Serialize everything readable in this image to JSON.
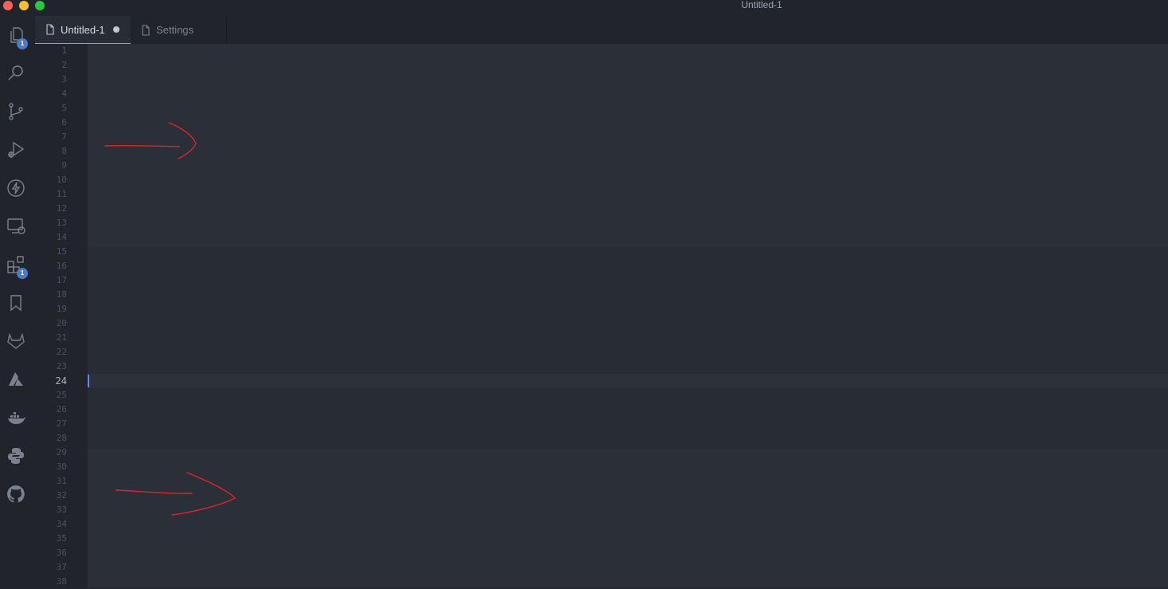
{
  "window": {
    "title": "Untitled-1"
  },
  "activity_bar": {
    "items": [
      {
        "icon": "files-icon",
        "badge": "1"
      },
      {
        "icon": "search-icon"
      },
      {
        "icon": "source-control-icon"
      },
      {
        "icon": "run-debug-icon"
      },
      {
        "icon": "lightning-icon"
      },
      {
        "icon": "remote-explorer-icon"
      },
      {
        "icon": "extensions-icon",
        "badge": "1"
      },
      {
        "icon": "bookmark-icon"
      },
      {
        "icon": "gitlab-icon"
      },
      {
        "icon": "azure-icon"
      },
      {
        "icon": "docker-icon"
      },
      {
        "icon": "python-icon"
      },
      {
        "icon": "github-icon"
      }
    ],
    "badges": {
      "files": "1",
      "extensions": "1"
    }
  },
  "tabs": {
    "active": {
      "label": "Untitled-1",
      "dirty": true
    },
    "inactive": {
      "label": "Settings"
    }
  },
  "editor": {
    "line_numbers": [
      "1",
      "2",
      "3",
      "4",
      "5",
      "6",
      "7",
      "8",
      "9",
      "10",
      "11",
      "12",
      "13",
      "14",
      "15",
      "16",
      "17",
      "18",
      "19",
      "20",
      "21",
      "22",
      "23",
      "24",
      "25",
      "26",
      "27",
      "28",
      "29",
      "30",
      "31",
      "32",
      "33",
      "34",
      "35",
      "36",
      "37",
      "38"
    ],
    "current_line": "24",
    "annotations": [
      "red-arrow",
      "red-arrow"
    ],
    "colors": {
      "background": "#282c34",
      "gutter": "#21252b",
      "cursor": "#528bff",
      "annotation": "#e0232b"
    }
  }
}
